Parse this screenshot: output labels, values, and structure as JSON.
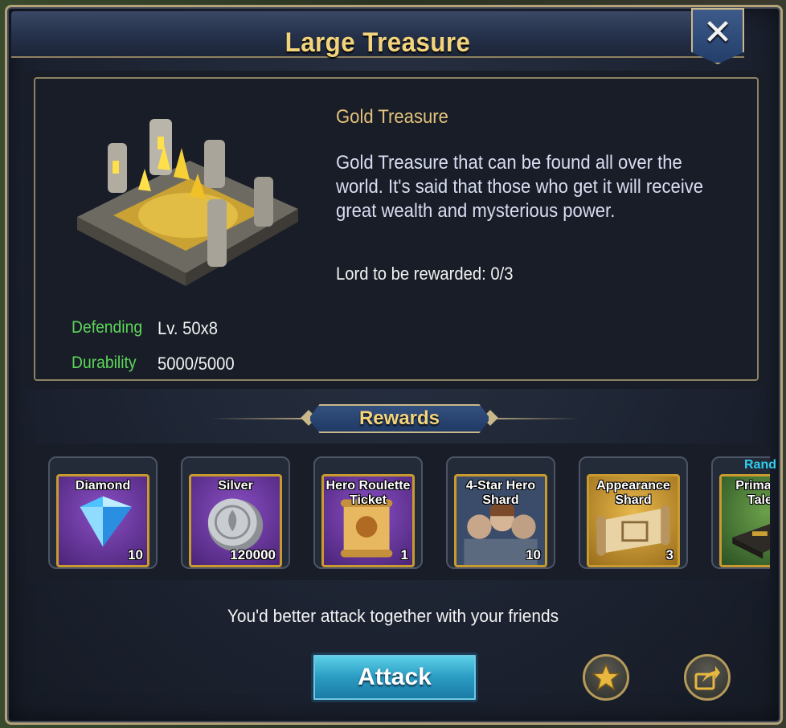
{
  "window": {
    "title": "Large Treasure",
    "close_icon": "close-icon"
  },
  "treasure": {
    "name": "Gold Treasure",
    "description": "Gold Treasure that can be found all over the world. It's said that those who get it will receive great wealth and mysterious power.",
    "lord_reward": "Lord to be rewarded: 0/3",
    "stats": [
      {
        "label": "Defending",
        "value": "Lv. 50x8"
      },
      {
        "label": "Durability",
        "value": "5000/5000"
      }
    ]
  },
  "rewards": {
    "heading": "Rewards",
    "random_tag": "Rand",
    "items": [
      {
        "name": "Diamond",
        "qty": "10",
        "icon": "diamond-icon",
        "rarity": "purple"
      },
      {
        "name": "Silver",
        "qty": "120000",
        "icon": "silver-coin-icon",
        "rarity": "purple"
      },
      {
        "name": "Hero Roulette Ticket",
        "qty": "1",
        "icon": "scroll-icon",
        "rarity": "purple"
      },
      {
        "name": "4-Star Hero Shard",
        "qty": "10",
        "icon": "heroes-portrait-icon",
        "rarity": "gold"
      },
      {
        "name": "Appearance Shard",
        "qty": "3",
        "icon": "map-scroll-icon",
        "rarity": "gold"
      },
      {
        "name": "Primary R Talent",
        "qty": "",
        "icon": "book-icon",
        "rarity": "green"
      }
    ]
  },
  "hint": "You'd better attack together with your friends",
  "actions": {
    "attack_label": "Attack",
    "favorite_icon": "star-icon",
    "share_icon": "share-icon"
  },
  "colors": {
    "title_gold": "#f3d47c",
    "stat_green": "#5ed65a",
    "attack_cyan": "#2a9bc2",
    "random_cyan": "#2fd0f0"
  }
}
